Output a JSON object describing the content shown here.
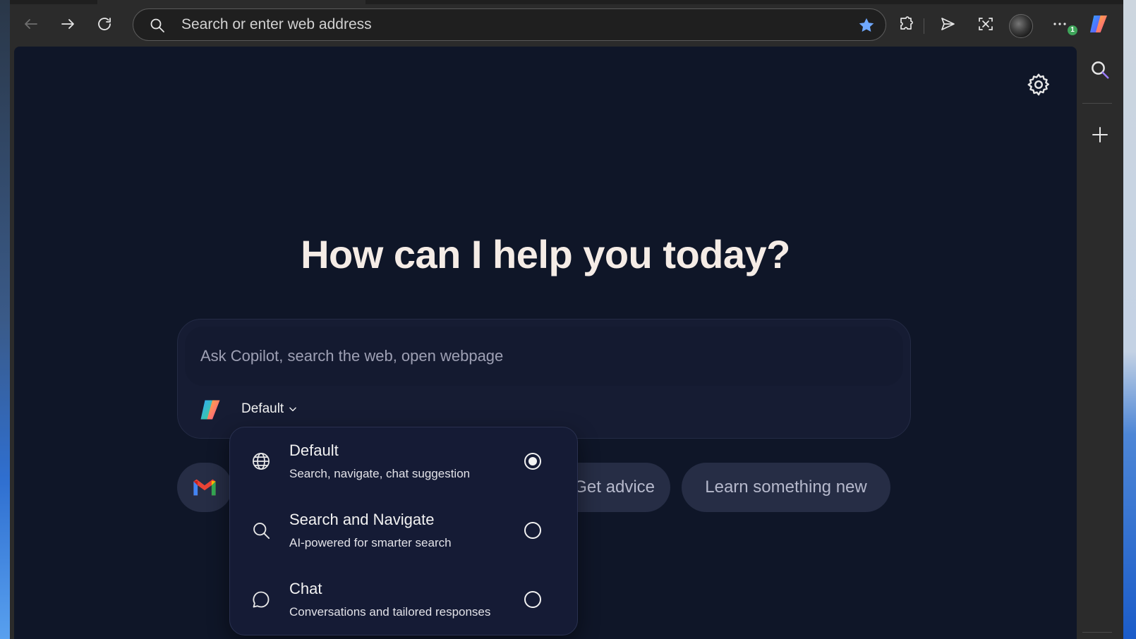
{
  "toolbar": {
    "address_placeholder": "Search or enter web address"
  },
  "page": {
    "headline": "How can I help you today?",
    "ask_placeholder": "Ask Copilot, search the web, open webpage",
    "mode_label": "Default"
  },
  "chips": [
    {
      "label": "Get advice"
    },
    {
      "label": "Learn something new"
    }
  ],
  "modes": [
    {
      "title": "Default",
      "subtitle": "Search, navigate, chat suggestion",
      "icon": "globe-icon",
      "selected": true
    },
    {
      "title": "Search and Navigate",
      "subtitle": "AI-powered for smarter search",
      "icon": "search-icon",
      "selected": false
    },
    {
      "title": "Chat",
      "subtitle": "Conversations and tailored responses",
      "icon": "chat-bubble-icon",
      "selected": false
    }
  ],
  "notification_badge": "1",
  "colors": {
    "page_bg": "#0f1628",
    "chrome_bg": "#2b2b2b",
    "accent_star": "#6fa8ff",
    "headline": "#f5ece6"
  }
}
